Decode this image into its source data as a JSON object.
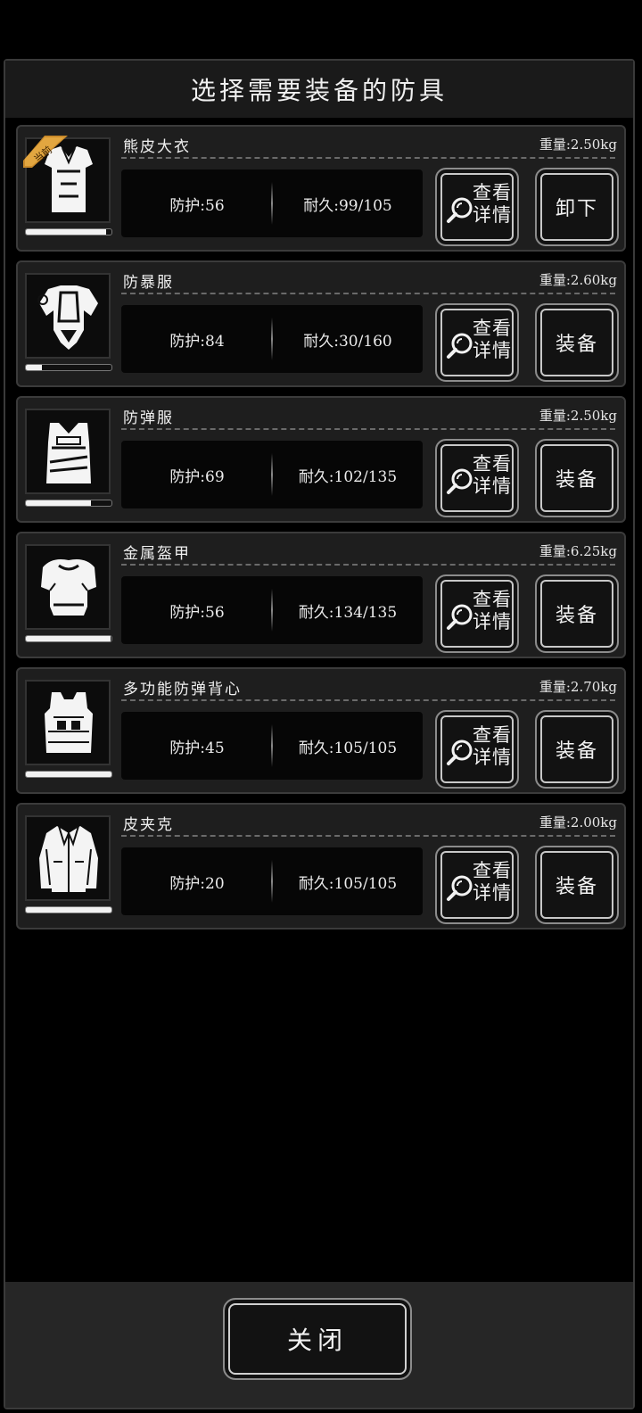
{
  "dialog": {
    "title": "选择需要装备的防具"
  },
  "items": [
    {
      "name": "熊皮大衣",
      "weight": "重量:2.50kg",
      "defense": "防护:56",
      "durability": "耐久:99/105",
      "durability_fraction": 0.94,
      "current_badge": "当前",
      "detail_label": "查看详情",
      "action_label": "卸下",
      "icon": "fur-coat-icon"
    },
    {
      "name": "防暴服",
      "weight": "重量:2.60kg",
      "defense": "防护:84",
      "durability": "耐久:30/160",
      "durability_fraction": 0.19,
      "detail_label": "查看详情",
      "action_label": "装备",
      "icon": "riot-suit-icon"
    },
    {
      "name": "防弹服",
      "weight": "重量:2.50kg",
      "defense": "防护:69",
      "durability": "耐久:102/135",
      "durability_fraction": 0.76,
      "detail_label": "查看详情",
      "action_label": "装备",
      "icon": "bulletproof-vest-icon"
    },
    {
      "name": "金属盔甲",
      "weight": "重量:6.25kg",
      "defense": "防护:56",
      "durability": "耐久:134/135",
      "durability_fraction": 0.99,
      "detail_label": "查看详情",
      "action_label": "装备",
      "icon": "metal-armor-icon"
    },
    {
      "name": "多功能防弹背心",
      "weight": "重量:2.70kg",
      "defense": "防护:45",
      "durability": "耐久:105/105",
      "durability_fraction": 1.0,
      "detail_label": "查看详情",
      "action_label": "装备",
      "icon": "tactical-vest-icon"
    },
    {
      "name": "皮夹克",
      "weight": "重量:2.00kg",
      "defense": "防护:20",
      "durability": "耐久:105/105",
      "durability_fraction": 1.0,
      "detail_label": "查看详情",
      "action_label": "装备",
      "icon": "leather-jacket-icon"
    }
  ],
  "footer": {
    "close_label": "关闭"
  }
}
